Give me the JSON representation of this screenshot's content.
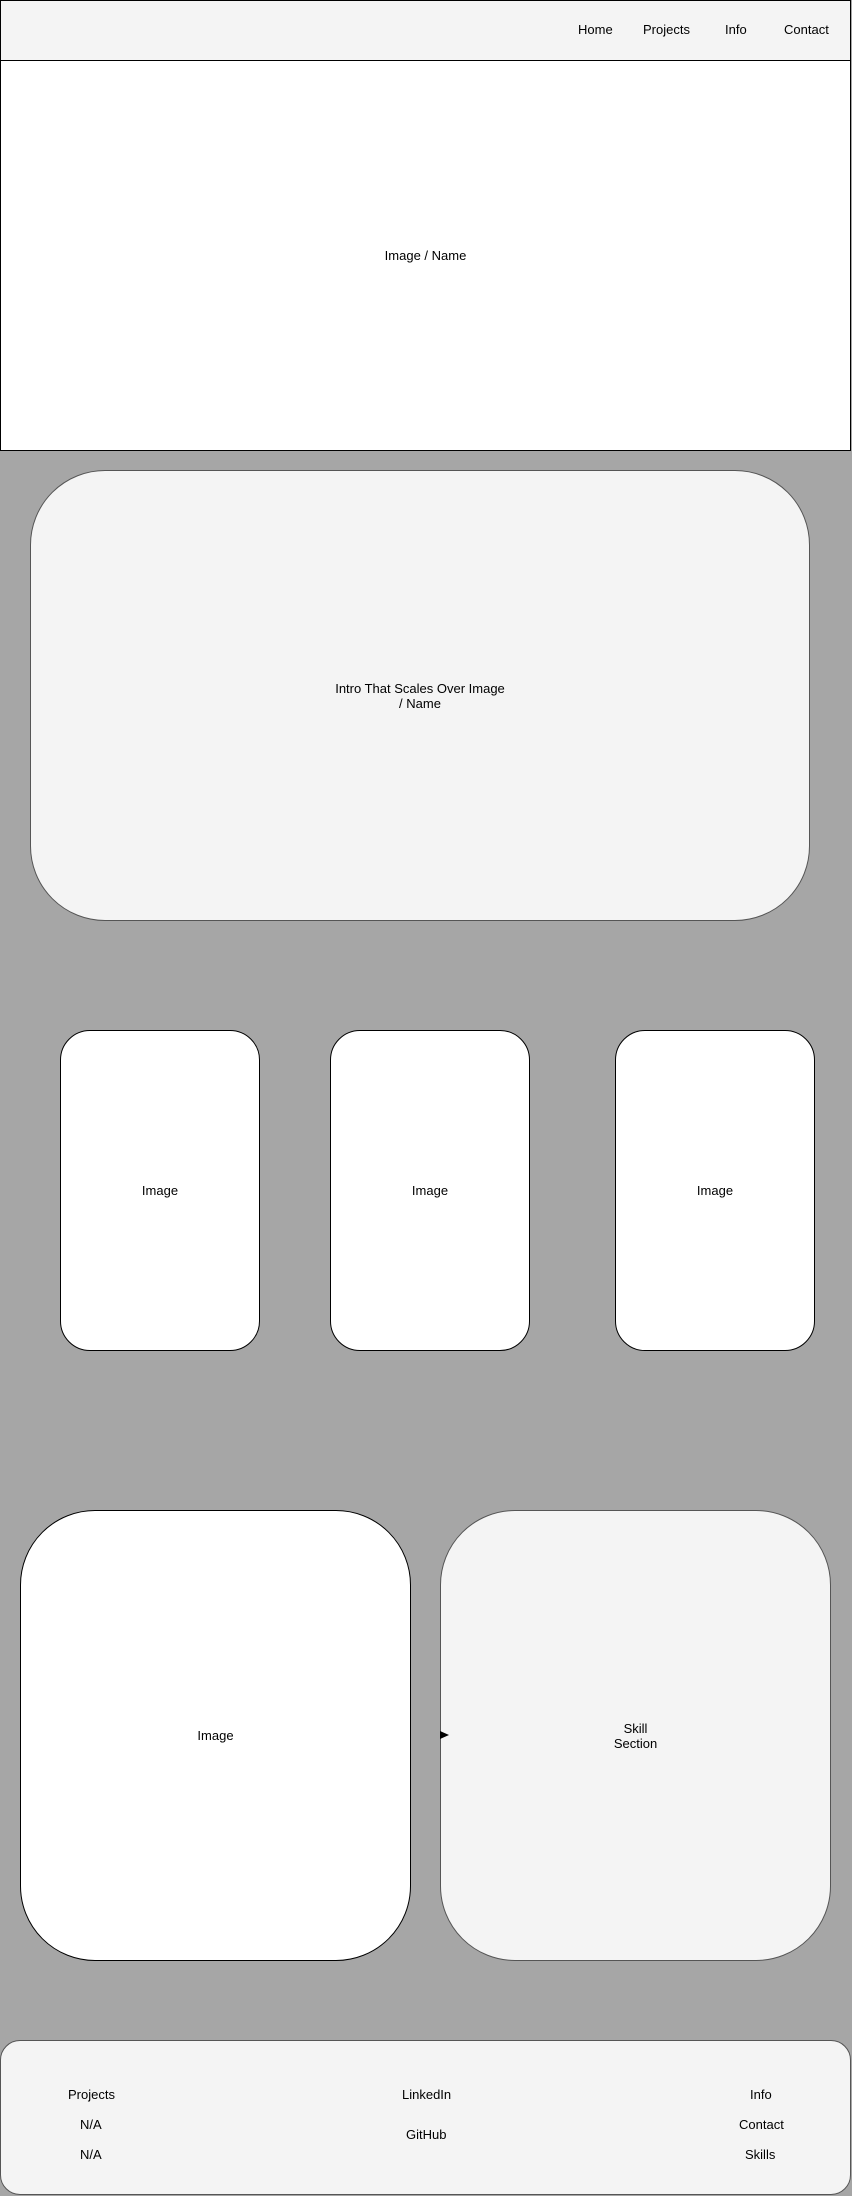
{
  "nav": {
    "home": "Home",
    "projects": "Projects",
    "info": "Info",
    "contact": "Contact"
  },
  "hero": {
    "label": "Image / Name"
  },
  "intro": {
    "label": "Intro That Scales Over Image / Name"
  },
  "gallery": {
    "card1": "Image",
    "card2": "Image",
    "card3": "Image"
  },
  "feature": {
    "image_label": "Image",
    "skills_label": "Skill Section"
  },
  "footer": {
    "col1": [
      "Projects",
      "N/A",
      "N/A"
    ],
    "col2": [
      "LinkedIn",
      "GitHub"
    ],
    "col3": [
      "Info",
      "Contact",
      "Skills"
    ]
  }
}
